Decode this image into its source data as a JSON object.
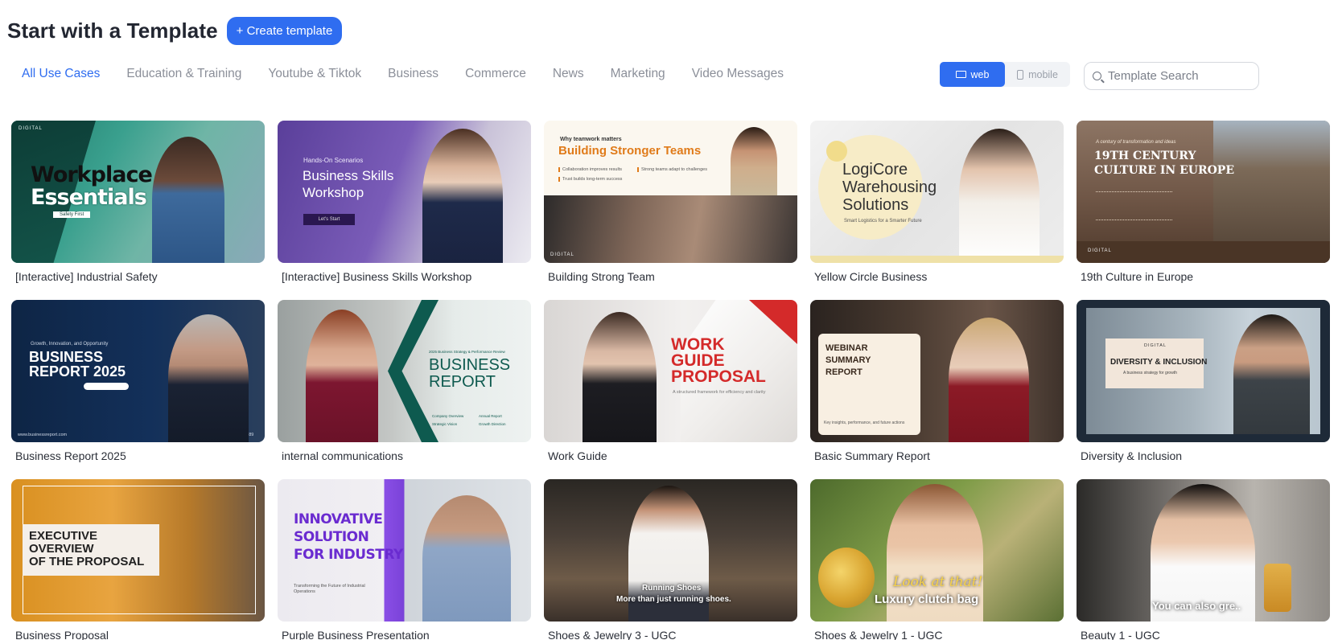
{
  "header": {
    "title": "Start with a Template",
    "create_button": "+ Create template"
  },
  "tabs": [
    {
      "label": "All Use Cases",
      "active": true
    },
    {
      "label": "Education & Training",
      "active": false
    },
    {
      "label": "Youtube & Tiktok",
      "active": false
    },
    {
      "label": "Business",
      "active": false
    },
    {
      "label": "Commerce",
      "active": false
    },
    {
      "label": "News",
      "active": false
    },
    {
      "label": "Marketing",
      "active": false
    },
    {
      "label": "Video Messages",
      "active": false
    }
  ],
  "view_toggle": {
    "web_label": "web",
    "mobile_label": "mobile",
    "selected": "web"
  },
  "search": {
    "placeholder": "Template Search",
    "icon": "search-icon"
  },
  "colors": {
    "accent": "#2f6df0",
    "tab_inactive": "#8b8f99"
  },
  "templates": [
    {
      "label": "[Interactive] Industrial Safety",
      "thumb_text": {
        "brand": "DIGITAL",
        "headline_1": "Workplace",
        "headline_2": "Essentials",
        "tag": "Safety First"
      }
    },
    {
      "label": "[Interactive] Business Skills Workshop",
      "thumb_text": {
        "kicker": "Hands-On Scenarios",
        "headline_1": "Business Skills",
        "headline_2": "Workshop",
        "button": "Let's Start"
      }
    },
    {
      "label": "Building Strong Team",
      "thumb_text": {
        "kicker": "Why teamwork matters",
        "headline": "Building Stronger Teams",
        "bullet_1": "Collaboration improves results",
        "bullet_2": "Strong teams adapt to challenges",
        "bullet_3": "Trust builds long-term success",
        "brand": "DIGITAL"
      }
    },
    {
      "label": "Yellow Circle Business",
      "thumb_text": {
        "headline_1": "LogiCore",
        "headline_2": "Warehousing",
        "headline_3": "Solutions",
        "sub": "Smart Logistics for a Smarter Future"
      }
    },
    {
      "label": "19th Culture in Europe",
      "thumb_text": {
        "kicker": "A century of transformation and ideas",
        "headline_1": "19TH CENTURY",
        "headline_2": "CULTURE IN EUROPE",
        "brand": "DIGITAL"
      }
    },
    {
      "label": "Business Report 2025",
      "thumb_text": {
        "kicker": "Growth, Innovation, and Opportunity",
        "headline_1": "BUSINESS",
        "headline_2": "REPORT 2025",
        "url": "www.businessreport.com",
        "phone": "00-3456789"
      }
    },
    {
      "label": "internal communications",
      "thumb_text": {
        "kicker": "2025 Business Strategy & Performance Review",
        "headline_1": "BUSINESS",
        "headline_2": "REPORT",
        "item_1": "Company Overview",
        "item_2": "Annual Report",
        "item_3": "Strategic Vision",
        "item_4": "Growth Direction"
      }
    },
    {
      "label": "Work Guide",
      "thumb_text": {
        "headline_1": "WORK",
        "headline_2": "GUIDE",
        "headline_3": "PROPOSAL",
        "sub": "A structured framework for efficiency and clarity"
      }
    },
    {
      "label": "Basic Summary Report",
      "thumb_text": {
        "headline_1": "WEBINAR",
        "headline_2": "SUMMARY",
        "headline_3": "REPORT",
        "sub": "Key insights, performance, and future actions"
      }
    },
    {
      "label": "Diversity & Inclusion",
      "thumb_text": {
        "brand": "DIGITAL",
        "headline": "DIVERSITY & INCLUSION",
        "sub": "A business strategy for growth"
      }
    },
    {
      "label": "Business Proposal",
      "thumb_text": {
        "headline_1": "EXECUTIVE",
        "headline_2": "OVERVIEW",
        "headline_3": "OF THE PROPOSAL"
      }
    },
    {
      "label": "Purple Business Presentation",
      "thumb_text": {
        "headline_1": "INNOVATIVE",
        "headline_2": "SOLUTION",
        "headline_3": "FOR INDUSTRY",
        "sub": "Transforming the Future of Industrial Operations"
      }
    },
    {
      "label": "Shoes & Jewelry 3 - UGC",
      "thumb_text": {
        "caption_1": "Running Shoes",
        "caption_2": "More than just running shoes."
      }
    },
    {
      "label": "Shoes & Jewelry 1 - UGC",
      "thumb_text": {
        "caption_1": "Look at that!",
        "caption_2": "Luxury clutch bag"
      }
    },
    {
      "label": "Beauty 1 - UGC",
      "thumb_text": {
        "caption_1": "You can also gre.."
      }
    }
  ]
}
